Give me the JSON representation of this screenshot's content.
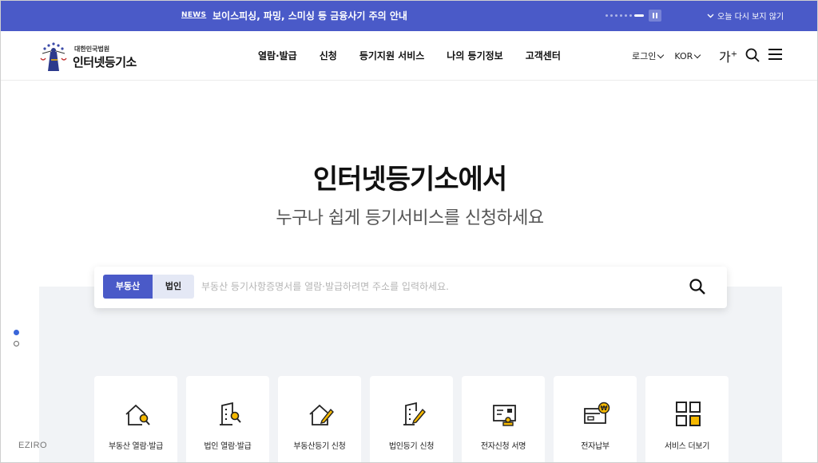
{
  "notice": {
    "tag": "NEWS",
    "message": "보이스피싱, 파밍, 스미싱 등 금융사기 주의 안내",
    "close_today": "오늘 다시 보지 않기"
  },
  "header": {
    "logo_sub": "대한민국법원",
    "logo_main": "인터넷등기소",
    "nav": [
      "열람·발급",
      "신청",
      "등기지원 서비스",
      "나의 등기정보",
      "고객센터"
    ],
    "login": "로그인",
    "language": "KOR",
    "font_size": "가"
  },
  "hero": {
    "title": "인터넷등기소에서",
    "subtitle": "누구나 쉽게 등기서비스를 신청하세요"
  },
  "search": {
    "tab_real_estate": "부동산",
    "tab_corporation": "법인",
    "placeholder": "부동산 등기사항증명서를 열람·발급하려면 주소를 입력하세요."
  },
  "cards": [
    {
      "label": "부동산 열람·발급",
      "icon": "house-search-icon"
    },
    {
      "label": "법인 열람·발급",
      "icon": "building-search-icon"
    },
    {
      "label": "부동산등기 신청",
      "icon": "house-pen-icon"
    },
    {
      "label": "법인등기 신청",
      "icon": "building-pen-icon"
    },
    {
      "label": "전자신청 서명",
      "icon": "signature-stamp-icon"
    },
    {
      "label": "전자납부",
      "icon": "card-won-icon"
    },
    {
      "label": "서비스 더보기",
      "icon": "grid-more-icon"
    }
  ],
  "watermark": "EZIRO",
  "colors": {
    "primary": "#4a5ac8",
    "accent": "#f5b800",
    "panel": "#f1f3f6"
  }
}
